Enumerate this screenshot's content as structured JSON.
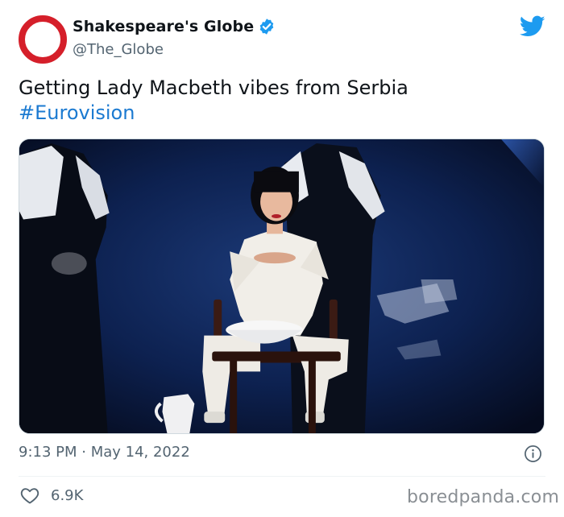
{
  "account": {
    "display_name": "Shakespeare's Globe",
    "handle": "@The_Globe",
    "verified": true,
    "avatar_icon": "red-ring-logo",
    "brand_color": "#d51f2a"
  },
  "platform": {
    "logo_icon": "twitter-bird-icon",
    "accent_color": "#1d9bf0"
  },
  "tweet": {
    "text": "Getting Lady Macbeth vibes from Serbia",
    "hashtag": "#Eurovision",
    "hashtag_color": "#1b7ad1",
    "timestamp": "9:13 PM · May 14, 2022",
    "info_icon": "info-icon"
  },
  "engagement": {
    "like_icon": "heart-icon",
    "likes": "6.9K"
  },
  "watermark": "boredpanda.com"
}
